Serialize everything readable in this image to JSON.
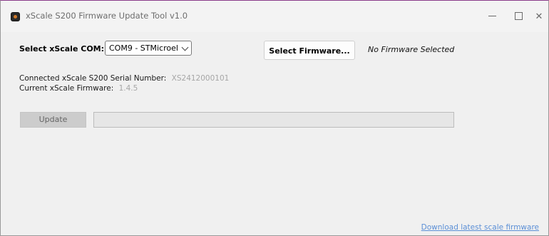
{
  "window": {
    "title": "xScale S200 Firmware Update Tool v1.0"
  },
  "com": {
    "label": "Select xScale COM:",
    "selected": "COM9 - STMicroel"
  },
  "firmware": {
    "button_label": "Select Firmware...",
    "status": "No Firmware Selected"
  },
  "device": {
    "serial_label": "Connected xScale S200 Serial Number:",
    "serial_value": "XS2412000101",
    "firmware_label": "Current xScale Firmware:",
    "firmware_value": "1.4.5"
  },
  "update": {
    "button_label": "Update",
    "progress": 0
  },
  "link": {
    "download_label": "Download latest scale firmware"
  },
  "icons": {
    "app": "app-icon",
    "minimize": "minimize-icon",
    "maximize": "maximize-icon",
    "close": "close-icon",
    "dropdown": "chevron-down-icon"
  },
  "colors": {
    "link": "#5b8fd6",
    "disabled_text": "#a6a6a6"
  }
}
